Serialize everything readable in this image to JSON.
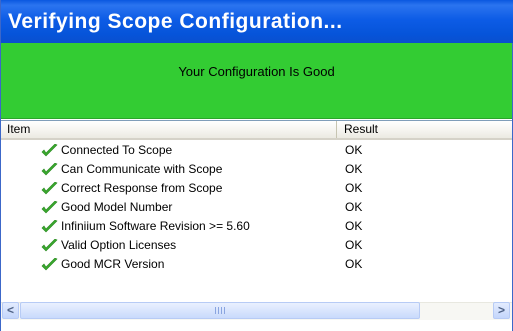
{
  "window": {
    "title": "Verifying Scope Configuration..."
  },
  "status": {
    "message": "Your Configuration Is Good",
    "color": "#33cc33"
  },
  "list": {
    "columns": [
      "Item",
      "Result"
    ],
    "rows": [
      {
        "icon": "checkmark-icon",
        "item": "Connected To Scope",
        "result": "OK"
      },
      {
        "icon": "checkmark-icon",
        "item": "Can Communicate with Scope",
        "result": "OK"
      },
      {
        "icon": "checkmark-icon",
        "item": "Correct Response from Scope",
        "result": "OK"
      },
      {
        "icon": "checkmark-icon",
        "item": "Good Model Number",
        "result": "OK"
      },
      {
        "icon": "checkmark-icon",
        "item": "Infiniium Software Revision >= 5.60",
        "result": "OK"
      },
      {
        "icon": "checkmark-icon",
        "item": "Valid Option Licenses",
        "result": "OK"
      },
      {
        "icon": "checkmark-icon",
        "item": "Good MCR Version",
        "result": "OK"
      }
    ]
  },
  "scrollbar": {
    "left_arrow": "<",
    "right_arrow": ">"
  }
}
